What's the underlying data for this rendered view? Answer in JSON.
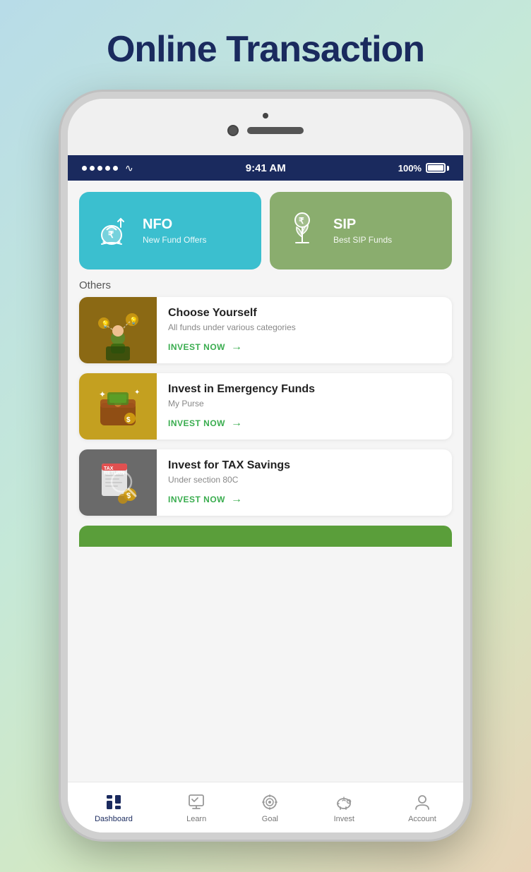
{
  "page": {
    "title": "Online Transaction",
    "background": "gradient"
  },
  "status_bar": {
    "time": "9:41 AM",
    "battery": "100%",
    "signal_dots": 5
  },
  "top_cards": [
    {
      "id": "nfo",
      "title": "NFO",
      "subtitle": "New Fund Offers",
      "bg_color": "#3bbfcf"
    },
    {
      "id": "sip",
      "title": "SIP",
      "subtitle": "Best SIP Funds",
      "bg_color": "#8aad6e"
    }
  ],
  "others_label": "Others",
  "list_items": [
    {
      "id": "choose-yourself",
      "title": "Choose Yourself",
      "subtitle": "All funds under various categories",
      "cta": "INVEST NOW",
      "img_type": "choose"
    },
    {
      "id": "emergency-funds",
      "title": "Invest in Emergency Funds",
      "subtitle": "My Purse",
      "cta": "INVEST NOW",
      "img_type": "emergency"
    },
    {
      "id": "tax-savings",
      "title": "Invest for TAX Savings",
      "subtitle": "Under section 80C",
      "cta": "INVEST NOW",
      "img_type": "tax"
    }
  ],
  "bottom_nav": [
    {
      "id": "dashboard",
      "label": "Dashboard",
      "active": true
    },
    {
      "id": "learn",
      "label": "Learn",
      "active": false
    },
    {
      "id": "goal",
      "label": "Goal",
      "active": false
    },
    {
      "id": "invest",
      "label": "Invest",
      "active": false
    },
    {
      "id": "account",
      "label": "Account",
      "active": false
    }
  ]
}
